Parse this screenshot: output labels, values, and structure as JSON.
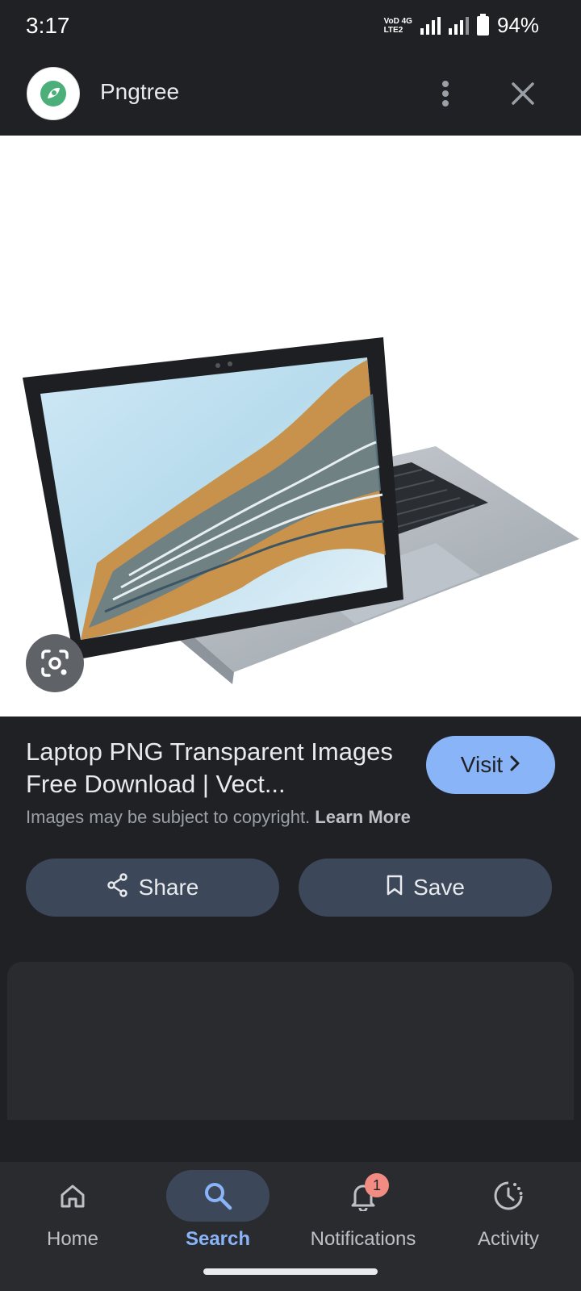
{
  "status_bar": {
    "time": "3:17",
    "network_label_top": "VoD 4G",
    "network_label_bottom": "LTE2",
    "battery": "94%"
  },
  "header": {
    "site_name": "Pngtree",
    "logo_icon": "pngtree-leaf-icon",
    "more_icon": "more-vert-icon",
    "close_icon": "close-icon"
  },
  "result": {
    "title": "Laptop PNG Transparent Images Free Download | Vect...",
    "copyright_text": "Images may be subject to copyright.",
    "learn_more": "Learn More",
    "visit_label": "Visit"
  },
  "actions": {
    "share_label": "Share",
    "save_label": "Save"
  },
  "bottom_nav": {
    "items": [
      {
        "label": "Home",
        "icon": "home-icon"
      },
      {
        "label": "Search",
        "icon": "search-icon",
        "active": true
      },
      {
        "label": "Notifications",
        "icon": "bell-icon",
        "badge": "1"
      },
      {
        "label": "Activity",
        "icon": "activity-icon"
      }
    ]
  },
  "colors": {
    "background": "#202124",
    "accent": "#8ab4f8",
    "button_bg": "#3c4759",
    "badge": "#f28b82"
  }
}
